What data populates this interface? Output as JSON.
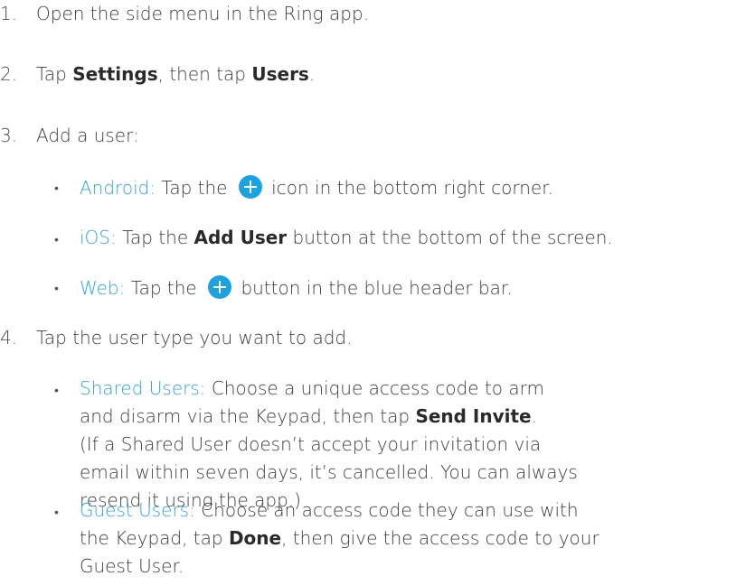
{
  "steps": [
    {
      "num": "1.",
      "text": "Open the side menu in the Ring app."
    },
    {
      "num": "2.",
      "pre": "Tap ",
      "bold1": "Settings",
      "mid": ", then tap ",
      "bold2": "Users",
      "post": "."
    },
    {
      "num": "3.",
      "text": "Add a user:"
    },
    {
      "num": "4.",
      "text": "Tap the user type you want to add."
    }
  ],
  "add_user": {
    "android": {
      "label": "Android:",
      "pre": " Tap the ",
      "icon": "plus-circle-icon",
      "post": " icon in the bottom right  corner."
    },
    "ios": {
      "label": "iOS:",
      "pre": " Tap the ",
      "bold": "Add User",
      "post": " button at the bottom of the screen."
    },
    "web": {
      "label": "Web:",
      "pre": " Tap the ",
      "icon": "plus-circle-icon",
      "post": " button in the blue header bar."
    }
  },
  "user_types": {
    "shared": {
      "label": "Shared Users:",
      "line1": " Choose a unique access code to arm",
      "line2_pre": "and disarm via the Keypad, then tap ",
      "line2_bold": "Send Invite",
      "line2_post": ".",
      "line3": "(If a Shared User doesn’t accept your invitation via",
      "line4": "email within seven days, it’s cancelled. You can always",
      "line5": "resend it using the app.)"
    },
    "guest": {
      "label": "Guest Users:",
      "line1": " Choose an access code they can use with",
      "line2_pre": "the Keypad, tap ",
      "line2_bold": "Done",
      "line2_post": ", then give the access code to your",
      "line3": "Guest User."
    }
  },
  "colors": {
    "accent": "#2aa6dd",
    "icon": "#1aa3e0",
    "text": "#3c3c3c"
  },
  "bullet_char": "•"
}
